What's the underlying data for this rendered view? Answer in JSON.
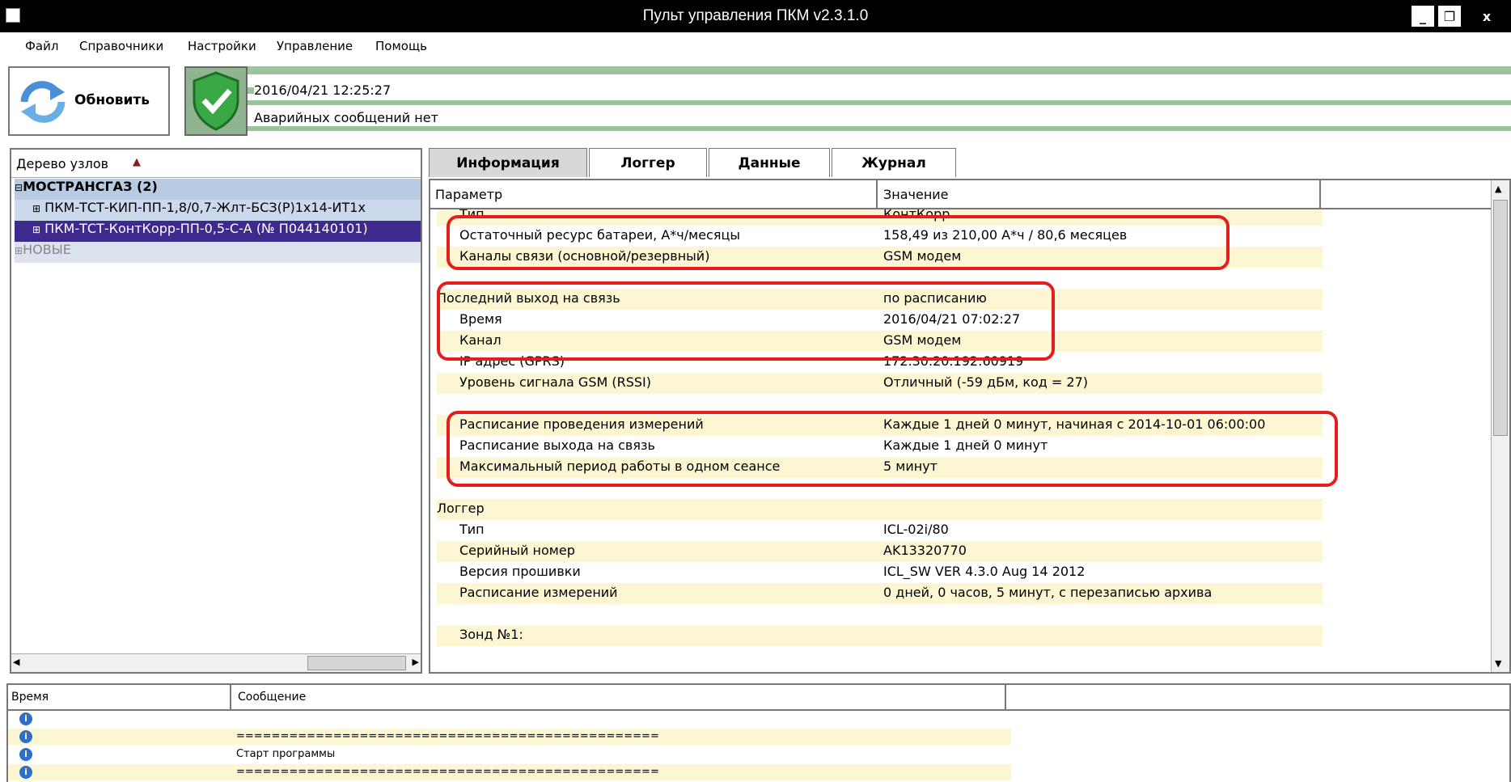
{
  "window": {
    "title": "Пульт управления ПКМ v2.3.1.0",
    "minimize": "_",
    "restore": "❐",
    "close": "x"
  },
  "menu": [
    "Файл",
    "Справочники",
    "Настройки",
    "Управление",
    "Помощь"
  ],
  "toolbar": {
    "refresh_label": "Обновить",
    "datetime": "2016/04/21 12:25:27",
    "alarm_status": "Аварийных сообщений нет"
  },
  "tree": {
    "header": "Дерево узлов",
    "group": "МОСТРАНСГАЗ (2)",
    "items": [
      "ПКМ-ТСТ-КИП-ПП-1,8/0,7-Жлт-БСЗ(Р)1х14-ИТ1х",
      "ПКМ-ТСТ-КонтКорр-ПП-0,5-С-А (№ П044140101)"
    ],
    "new_group": "НОВЫЕ"
  },
  "tabs": [
    "Информация",
    "Логгер",
    "Данные",
    "Журнал"
  ],
  "info_table": {
    "col_param": "Параметр",
    "col_value": "Значение",
    "rows": [
      {
        "param": "Тип",
        "value": "КонтКорр"
      },
      {
        "param": "Остаточный ресурс батареи, А*ч/месяцы",
        "value": "158,49 из 210,00 А*ч / 80,6 месяцев"
      },
      {
        "param": "Каналы связи (основной/резервный)",
        "value": "GSM модем"
      },
      {
        "param": "",
        "value": ""
      },
      {
        "param": "Последний выход на связь",
        "value": "по расписанию"
      },
      {
        "param": "Время",
        "value": "2016/04/21 07:02:27"
      },
      {
        "param": "Канал",
        "value": "GSM модем"
      },
      {
        "param": "IP адрес (GPRS)",
        "value": "172.30.20.192:60919"
      },
      {
        "param": "Уровень сигнала GSM (RSSI)",
        "value": "Отличный (-59 дБм, код = 27)"
      },
      {
        "param": "",
        "value": ""
      },
      {
        "param": "Расписание проведения измерений",
        "value": "Каждые 1 дней 0 минут, начиная с 2014-10-01 06:00:00"
      },
      {
        "param": "Расписание выхода на связь",
        "value": "Каждые 1 дней 0 минут"
      },
      {
        "param": "Максимальный период работы в одном сеансе",
        "value": "5 минут"
      },
      {
        "param": "",
        "value": ""
      },
      {
        "param": "Логгер",
        "value": ""
      },
      {
        "param": "Тип",
        "value": "ICL-02i/80"
      },
      {
        "param": "Серийный номер",
        "value": "AK13320770"
      },
      {
        "param": "Версия прошивки",
        "value": "ICL_SW VER 4.3.0 Aug 14 2012"
      },
      {
        "param": "Расписание измерений",
        "value": "0 дней, 0 часов, 5 минут, с перезаписью архива"
      },
      {
        "param": "",
        "value": ""
      },
      {
        "param": "Зонд №1:",
        "value": ""
      }
    ]
  },
  "log": {
    "col_time": "Время",
    "col_message": "Сообщение",
    "rows": [
      "",
      "================================================",
      "Старт программы",
      "================================================"
    ]
  }
}
